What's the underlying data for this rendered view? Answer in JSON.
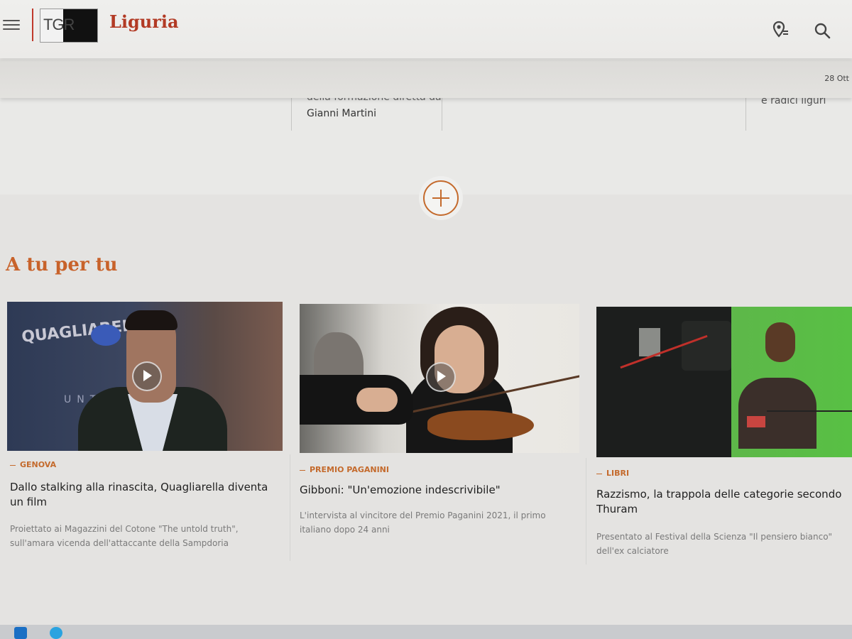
{
  "header": {
    "logo": "TGR",
    "region": "Liguria",
    "date": "28 Ott"
  },
  "previous_row": {
    "text_cut": "della formazione diretta da",
    "text_line": "Gianni Martini",
    "right_cut": "e radici liguri"
  },
  "section": {
    "title": "A tu per tu"
  },
  "cards": [
    {
      "kicker": "GENOVA",
      "title": "Dallo stalking alla rinascita, Quagliarella diventa un film",
      "desc": "Proiettato ai Magazzini del Cotone \"The untold truth\", sull'amara vicenda dell'attaccante della Sampdoria",
      "poster_text": "QUAGLIARELLA",
      "poster_text2": "UNTOLD TRUTH",
      "has_video": true
    },
    {
      "kicker": "PREMIO PAGANINI",
      "title": "Gibboni: \"Un'emozione indescrivibile\"",
      "desc": "L'intervista al vincitore del Premio Paganini 2021, il primo italiano dopo 24 anni",
      "has_video": true
    },
    {
      "kicker": "LIBRI",
      "title": "Razzismo, la trappola delle categorie secondo Thuram",
      "desc": "Presentato al Festival della Scienza \"Il pensiero bianco\" dell'ex calciatore",
      "has_video": false
    }
  ],
  "colors": {
    "brand_red": "#b23a24",
    "accent_orange": "#c46a2c"
  },
  "icons": [
    "menu-icon",
    "weather-icon",
    "search-icon",
    "plus-icon",
    "play-icon",
    "outlook-icon",
    "skype-icon"
  ]
}
